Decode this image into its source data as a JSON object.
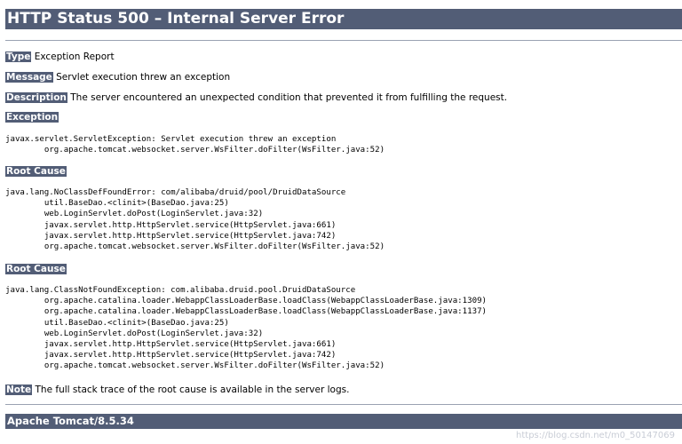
{
  "title": "HTTP Status 500 – Internal Server Error",
  "fields": {
    "type_label": "Type",
    "type_value": "Exception Report",
    "message_label": "Message",
    "message_value": "Servlet execution threw an exception",
    "description_label": "Description",
    "description_value": "The server encountered an unexpected condition that prevented it from fulfilling the request."
  },
  "exception": {
    "label": "Exception",
    "trace": "javax.servlet.ServletException: Servlet execution threw an exception\n\torg.apache.tomcat.websocket.server.WsFilter.doFilter(WsFilter.java:52)"
  },
  "root_causes": [
    {
      "label": "Root Cause",
      "trace": "java.lang.NoClassDefFoundError: com/alibaba/druid/pool/DruidDataSource\n\tutil.BaseDao.<clinit>(BaseDao.java:25)\n\tweb.LoginServlet.doPost(LoginServlet.java:32)\n\tjavax.servlet.http.HttpServlet.service(HttpServlet.java:661)\n\tjavax.servlet.http.HttpServlet.service(HttpServlet.java:742)\n\torg.apache.tomcat.websocket.server.WsFilter.doFilter(WsFilter.java:52)"
    },
    {
      "label": "Root Cause",
      "trace": "java.lang.ClassNotFoundException: com.alibaba.druid.pool.DruidDataSource\n\torg.apache.catalina.loader.WebappClassLoaderBase.loadClass(WebappClassLoaderBase.java:1309)\n\torg.apache.catalina.loader.WebappClassLoaderBase.loadClass(WebappClassLoaderBase.java:1137)\n\tutil.BaseDao.<clinit>(BaseDao.java:25)\n\tweb.LoginServlet.doPost(LoginServlet.java:32)\n\tjavax.servlet.http.HttpServlet.service(HttpServlet.java:661)\n\tjavax.servlet.http.HttpServlet.service(HttpServlet.java:742)\n\torg.apache.tomcat.websocket.server.WsFilter.doFilter(WsFilter.java:52)"
    }
  ],
  "note": {
    "label": "Note",
    "value": "The full stack trace of the root cause is available in the server logs."
  },
  "footer": "Apache Tomcat/8.5.34",
  "watermark": "https://blog.csdn.net/m0_50147069"
}
